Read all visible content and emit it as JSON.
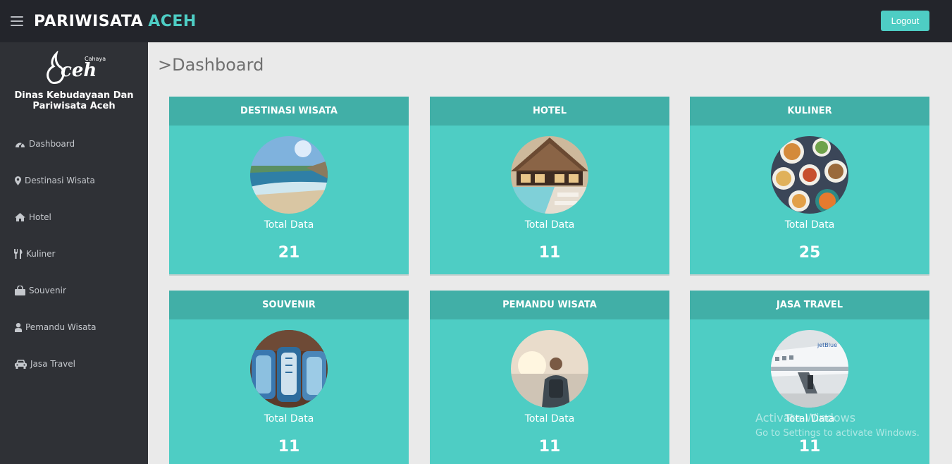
{
  "header": {
    "brand_part1": "PARIWISATA",
    "brand_part2": "ACEH",
    "logout_label": "Logout",
    "menu_icon": "hamburger-icon"
  },
  "sidebar": {
    "logo_small_text": "Cahaya",
    "logo_text": "Aceh",
    "org_name_line1": "Dinas Kebudayaan Dan",
    "org_name_line2": "Pariwisata Aceh",
    "items": [
      {
        "label": "Dashboard",
        "icon": "dashboard-icon"
      },
      {
        "label": "Destinasi Wisata",
        "icon": "map-marker-icon"
      },
      {
        "label": "Hotel",
        "icon": "home-icon"
      },
      {
        "label": "Kuliner",
        "icon": "cutlery-icon"
      },
      {
        "label": "Souvenir",
        "icon": "shopping-bag-icon"
      },
      {
        "label": "Pemandu Wisata",
        "icon": "user-icon"
      },
      {
        "label": "Jasa Travel",
        "icon": "car-icon"
      }
    ]
  },
  "main": {
    "title_prefix": ">",
    "title": "Dashboard",
    "cards": [
      {
        "title": "DESTINASI WISATA",
        "label": "Total Data",
        "value": "21"
      },
      {
        "title": "HOTEL",
        "label": "Total Data",
        "value": "11"
      },
      {
        "title": "KULINER",
        "label": "Total Data",
        "value": "25"
      },
      {
        "title": "SOUVENIR",
        "label": "Total Data",
        "value": "11"
      },
      {
        "title": "PEMANDU WISATA",
        "label": "Total Data",
        "value": "11"
      },
      {
        "title": "JASA TRAVEL",
        "label": "Total Data",
        "value": "11"
      }
    ]
  },
  "watermark": {
    "line1": "Activate Windows",
    "line2": "Go to Settings to activate Windows."
  },
  "colors": {
    "topbar": "#23252b",
    "sidebar": "#2f3136",
    "accent": "#4ecdc4",
    "card_header": "#41afa7",
    "content_bg": "#eaeaea"
  }
}
